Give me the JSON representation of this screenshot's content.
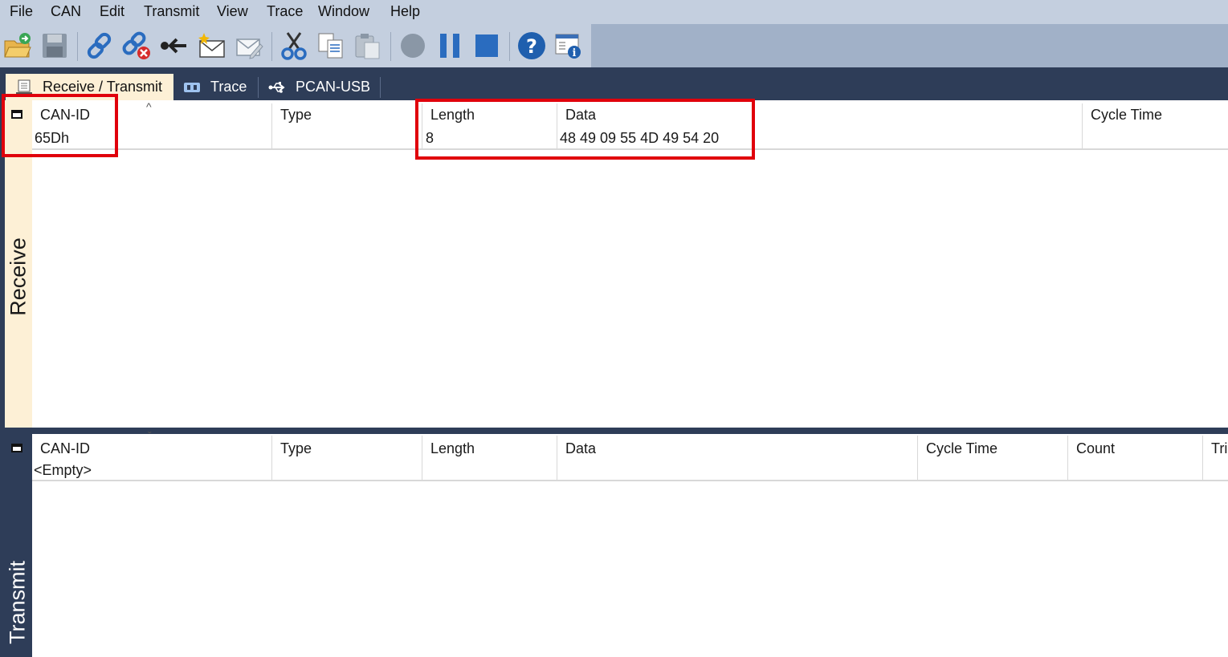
{
  "menu": [
    "File",
    "CAN",
    "Edit",
    "Transmit",
    "View",
    "Trace",
    "Window",
    "Help"
  ],
  "toolbar": {
    "buttons": [
      "open-folder-icon",
      "save-icon",
      "connect-icon",
      "disconnect-icon",
      "reset-icon",
      "new-message-icon",
      "edit-message-icon",
      "cut-icon",
      "copy-icon",
      "paste-icon",
      "record-icon",
      "pause-icon",
      "stop-icon",
      "help-icon",
      "window-info-icon"
    ]
  },
  "tabs": [
    {
      "label": "Receive / Transmit",
      "icon": "receive-transmit-icon",
      "active": true
    },
    {
      "label": "Trace",
      "icon": "trace-icon",
      "active": false
    },
    {
      "label": "PCAN-USB",
      "icon": "usb-icon",
      "active": false
    }
  ],
  "receive": {
    "side_label": "Receive",
    "columns": {
      "can_id": "CAN-ID",
      "type": "Type",
      "length": "Length",
      "data": "Data",
      "cycle_time": "Cycle Time"
    },
    "rows": [
      {
        "can_id": "65Dh",
        "type": "",
        "length": "8",
        "data": "48 49 09 55 4D 49 54 20",
        "cycle_time": ""
      }
    ]
  },
  "transmit": {
    "side_label": "Transmit",
    "columns": {
      "can_id": "CAN-ID",
      "type": "Type",
      "length": "Length",
      "data": "Data",
      "cycle_time": "Cycle Time",
      "count": "Count",
      "trigger": "Trig"
    },
    "rows": [
      {
        "can_id": "<Empty>"
      }
    ]
  },
  "colors": {
    "highlight": "#e0000b",
    "panel_dark": "#2e3d58",
    "receive_bg": "#fdf0d6",
    "toolbar_blue": "#2a6cbf"
  }
}
